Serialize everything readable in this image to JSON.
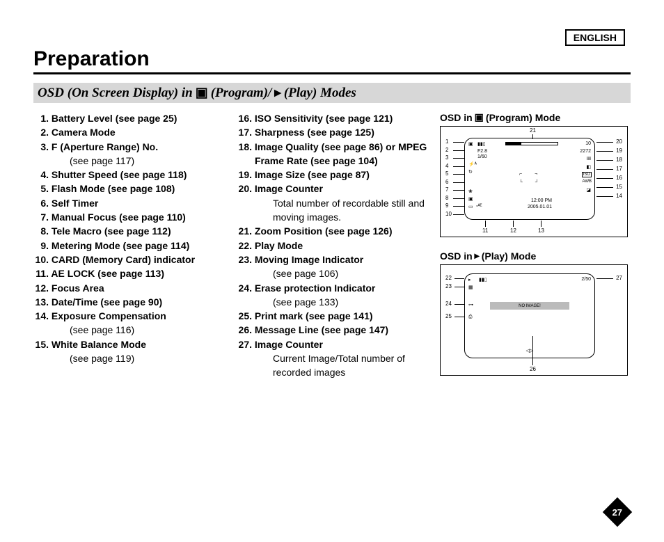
{
  "language_badge": "ENGLISH",
  "page_title": "Preparation",
  "section_heading": {
    "prefix": "OSD (On Screen Display) in ",
    "program": "(Program)/",
    "play": "(Play) Modes"
  },
  "left_list": [
    {
      "n": "1.",
      "label": "Battery Level (see page 25)"
    },
    {
      "n": "2.",
      "label": "Camera Mode"
    },
    {
      "n": "3.",
      "label": "F (Aperture Range) No.",
      "desc": "(see page 117)"
    },
    {
      "n": "4.",
      "label": "Shutter Speed (see page 118)"
    },
    {
      "n": "5.",
      "label": "Flash Mode (see page 108)"
    },
    {
      "n": "6.",
      "label": "Self Timer"
    },
    {
      "n": "7.",
      "label": "Manual Focus (see page 110)"
    },
    {
      "n": "8.",
      "label": "Tele Macro (see page 112)"
    },
    {
      "n": "9.",
      "label": "Metering Mode (see page 114)"
    },
    {
      "n": "10.",
      "label": "CARD (Memory Card) indicator"
    },
    {
      "n": "11.",
      "label": "AE LOCK (see page 113)"
    },
    {
      "n": "12.",
      "label": "Focus Area"
    },
    {
      "n": "13.",
      "label": "Date/Time (see page 90)"
    },
    {
      "n": "14.",
      "label": "Exposure Compensation",
      "desc": "(see page 116)"
    },
    {
      "n": "15.",
      "label": "White Balance Mode",
      "desc": "(see page 119)"
    }
  ],
  "right_list": [
    {
      "n": "16.",
      "label": "ISO Sensitivity (see page 121)"
    },
    {
      "n": "17.",
      "label": "Sharpness (see page 125)"
    },
    {
      "n": "18.",
      "label": "Image Quality (see page 86) or MPEG Frame Rate (see page 104)"
    },
    {
      "n": "19.",
      "label": "Image Size (see page 87)"
    },
    {
      "n": "20.",
      "label": "Image Counter",
      "desc": "Total number of recordable still and moving images."
    },
    {
      "n": "21.",
      "label": "Zoom Position (see page 126)"
    },
    {
      "n": "22.",
      "label": "Play Mode"
    },
    {
      "n": "23.",
      "label": "Moving Image Indicator",
      "desc": "(see page 106)"
    },
    {
      "n": "24.",
      "label": "Erase protection Indicator",
      "desc": "(see page 133)"
    },
    {
      "n": "25.",
      "label": "Print mark (see page 141)"
    },
    {
      "n": "26.",
      "label": "Message Line (see page 147)"
    },
    {
      "n": "27.",
      "label": "Image Counter",
      "desc": "Current Image/Total number of recorded images"
    }
  ],
  "side": {
    "program_title_prefix": "OSD in ",
    "program_title_suffix": "(Program) Mode",
    "play_title_prefix": "OSD in ",
    "play_title_suffix": "(Play) Mode"
  },
  "program_diagram": {
    "left_numbers": [
      "1",
      "2",
      "3",
      "4",
      "5",
      "6",
      "7",
      "8",
      "9",
      "10"
    ],
    "top_number": "21",
    "right_pairs": [
      [
        "10",
        "20"
      ],
      [
        "2272",
        "19"
      ],
      [
        "",
        "18"
      ],
      [
        "",
        "17"
      ],
      [
        "ISO",
        "16"
      ],
      [
        "AWB",
        "15"
      ],
      [
        "",
        "14"
      ]
    ],
    "bottom_numbers": [
      "11",
      "12",
      "13"
    ],
    "screen_text": {
      "aperture": "F2.8",
      "shutter": "1/60",
      "time": "12:00 PM",
      "date": "2005.01.01",
      "iso_label": "ISO",
      "awb_label": "AWB",
      "counter": "10",
      "size": "2272",
      "bars": "iiii"
    }
  },
  "play_diagram": {
    "left_numbers": [
      "22",
      "23",
      "24",
      "25"
    ],
    "right_pair": [
      "2/50",
      "27"
    ],
    "bottom_number": "26",
    "message": "NO IMAGE!"
  },
  "page_number": "27"
}
